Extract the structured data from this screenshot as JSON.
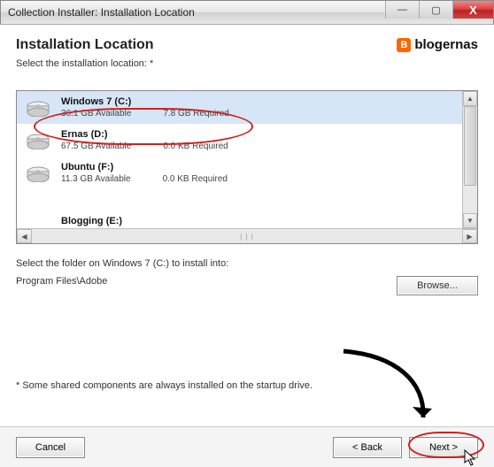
{
  "window": {
    "title": "Collection Installer: Installation Location",
    "minimize": "—",
    "maximize": "▢",
    "close": "X"
  },
  "header": {
    "title": "Installation Location",
    "subtitle": "Select the installation location: *",
    "brand_glyph": "B",
    "brand_text": "blogernas"
  },
  "drives": [
    {
      "name": "Windows 7 (C:)",
      "available": "36.1 GB Available",
      "required": "7.8 GB Required",
      "selected": true
    },
    {
      "name": "Ernas (D:)",
      "available": "67.5 GB Available",
      "required": "0.0 KB Required",
      "selected": false
    },
    {
      "name": "Ubuntu (F:)",
      "available": "11.3 GB Available",
      "required": "0.0 KB Required",
      "selected": false
    }
  ],
  "partial_drive_name": "Blogging (E:)",
  "folder": {
    "label": "Select the folder on Windows 7 (C:) to install into:",
    "path": "Program Files\\Adobe",
    "browse": "Browse..."
  },
  "footnote": "* Some shared components are always installed on the startup drive.",
  "buttons": {
    "cancel": "Cancel",
    "back": "< Back",
    "next": "Next >"
  }
}
